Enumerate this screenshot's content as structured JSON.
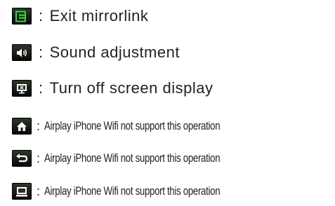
{
  "items": [
    {
      "icon": "exit-icon",
      "colon": ":",
      "text": "Exit mirrorlink"
    },
    {
      "icon": "speaker-icon",
      "colon": ":",
      "text": "Sound adjustment"
    },
    {
      "icon": "screen-off-icon",
      "colon": ":",
      "text": "Turn off screen display"
    },
    {
      "icon": "home-icon",
      "colon": ":",
      "text": "Airplay iPhone Wifi not support this operation"
    },
    {
      "icon": "back-icon",
      "colon": ":",
      "text": "Airplay iPhone Wifi not support this operation"
    },
    {
      "icon": "window-icon",
      "colon": ":",
      "text": "Airplay iPhone Wifi not support this operation"
    }
  ],
  "colors": {
    "icon_accent": "#2ecc2e",
    "icon_background": "#0b0b0b",
    "text": "#222222"
  }
}
